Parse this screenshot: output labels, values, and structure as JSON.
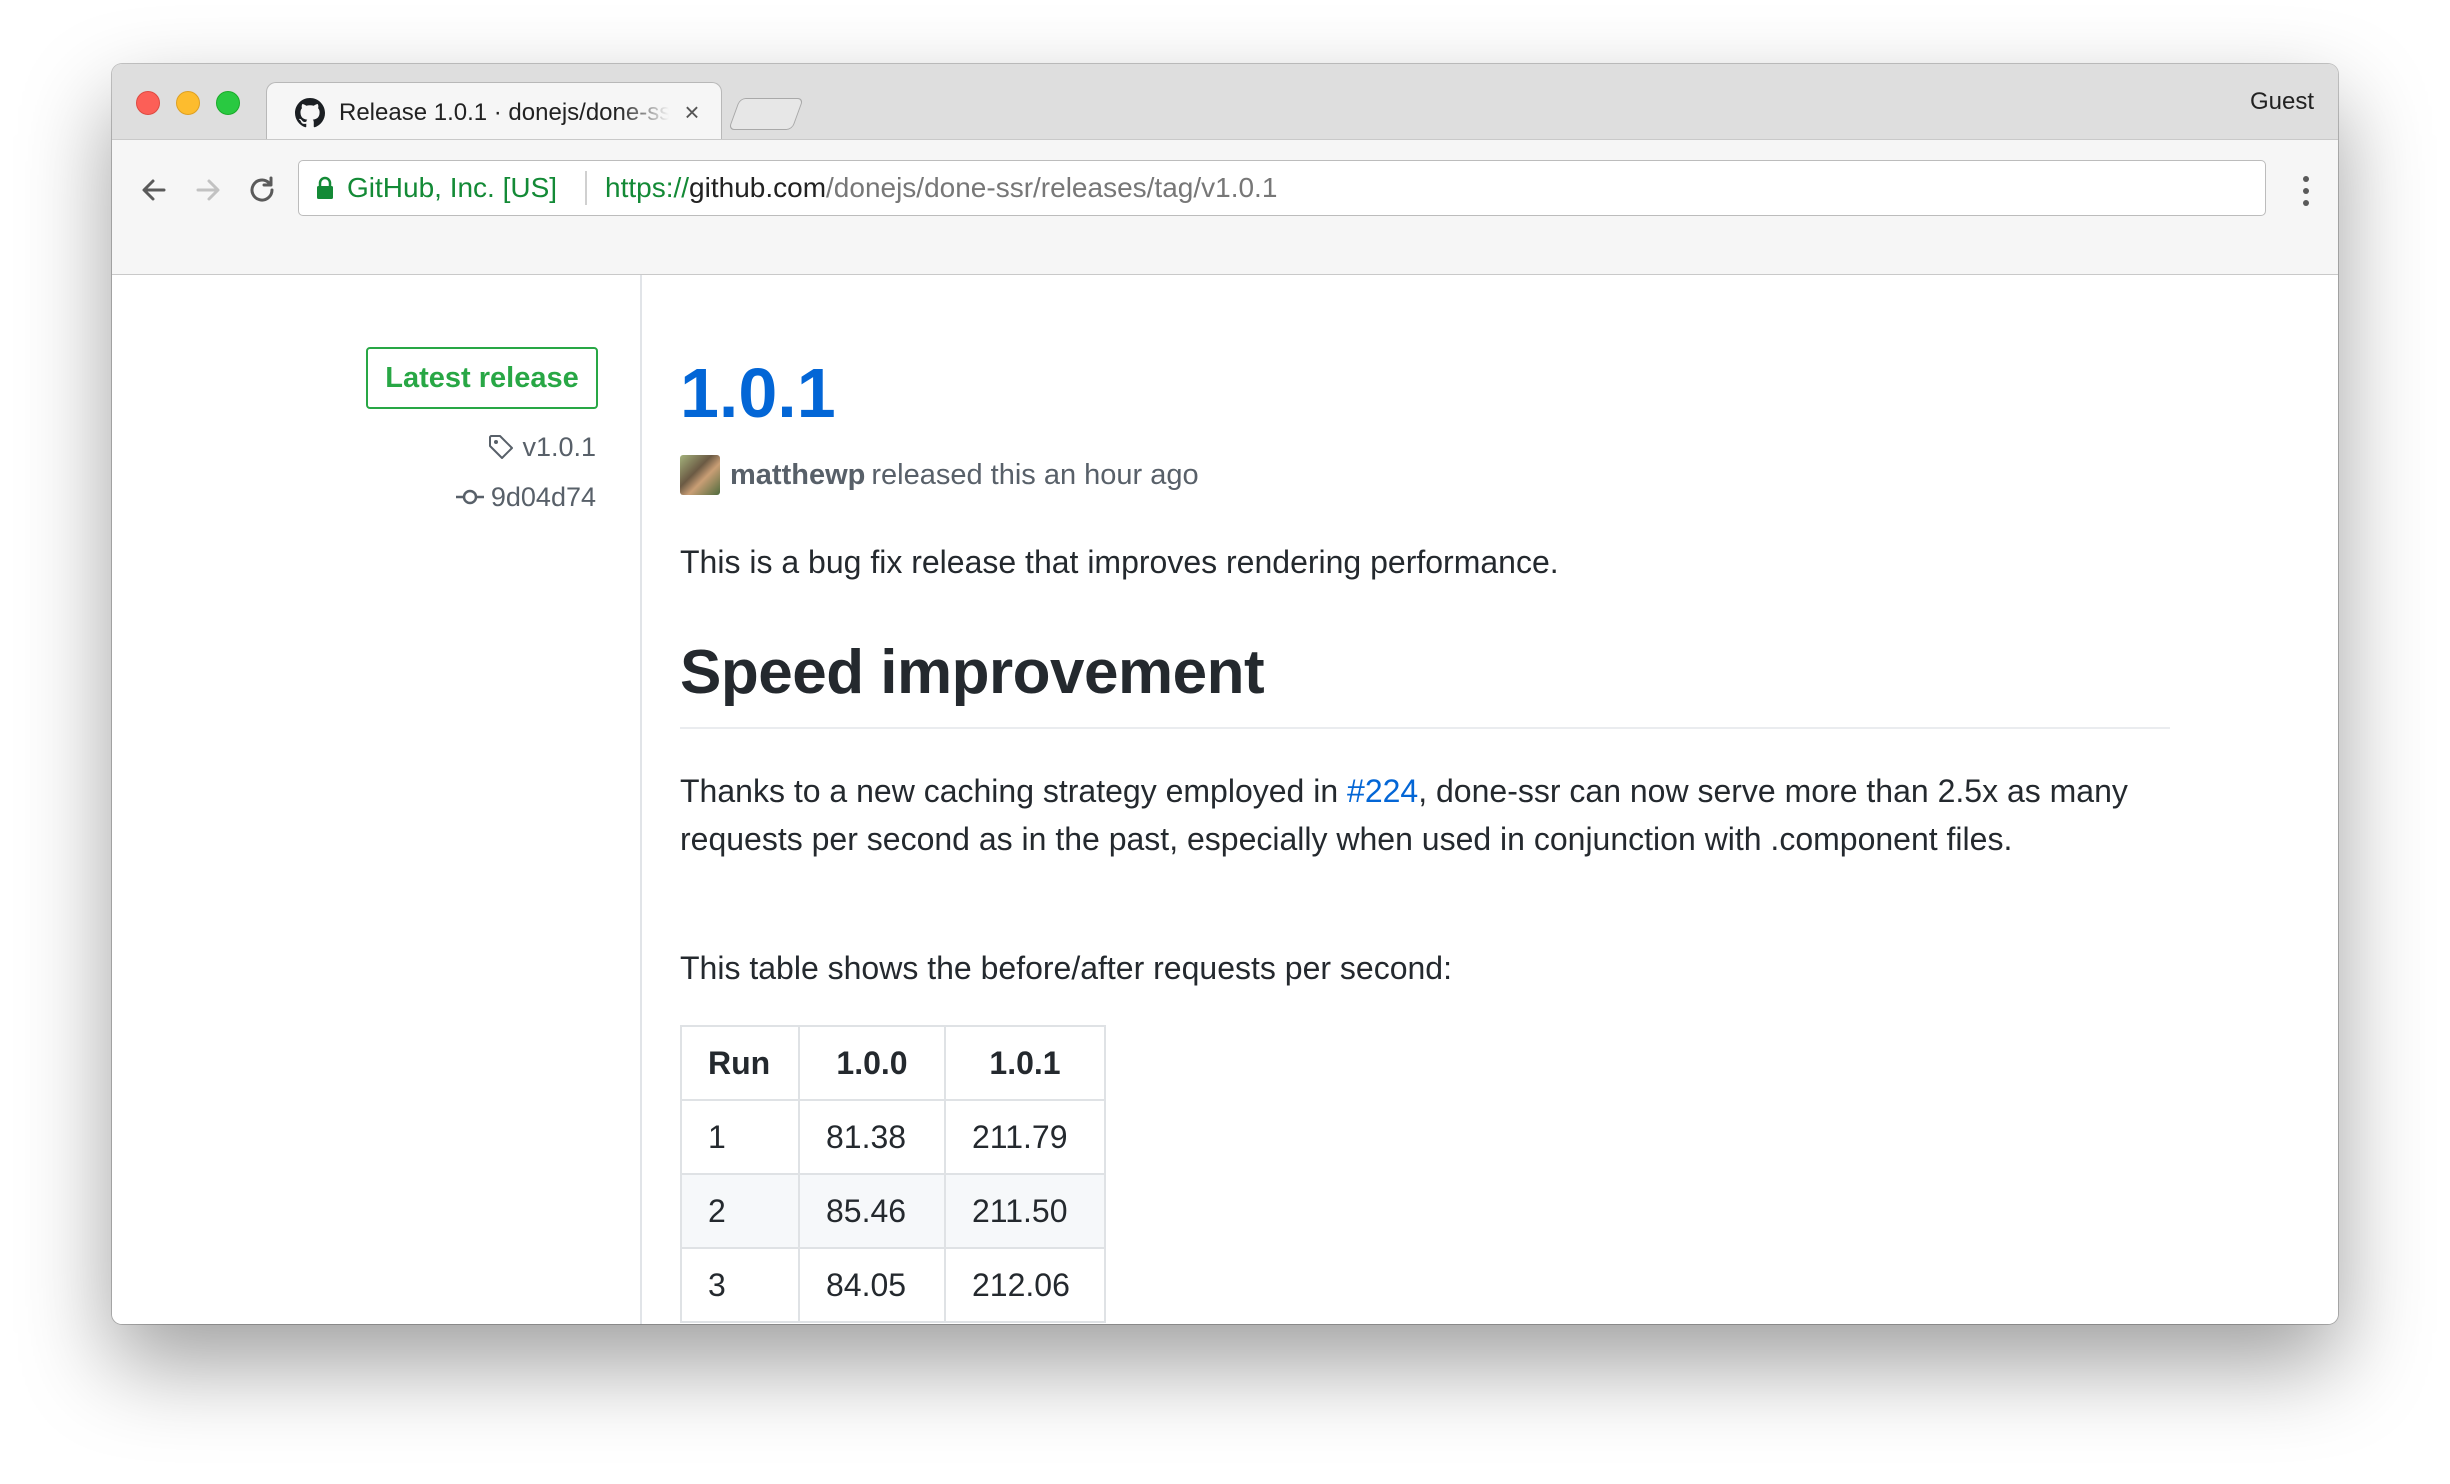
{
  "browser": {
    "tab_title": "Release 1.0.1 · donejs/done-ssr",
    "tab_close": "×",
    "profile": "Guest",
    "security_label": "GitHub, Inc. [US]",
    "url_scheme": "https://",
    "url_host": "github.com",
    "url_path": "/donejs/done-ssr/releases/tag/v1.0.1",
    "icons": {
      "back": "back-arrow-icon",
      "forward": "forward-arrow-icon",
      "reload": "reload-icon",
      "lock": "lock-icon",
      "menu": "kebab-menu-icon",
      "favicon": "github-octocat-icon"
    }
  },
  "sidebar": {
    "badge": "Latest release",
    "tag": "v1.0.1",
    "commit": "9d04d74",
    "accent": "#28a745"
  },
  "release": {
    "title": "1.0.1",
    "author": "matthewp",
    "released_text": "released this an hour ago",
    "intro": "This is a bug fix release that improves rendering performance.",
    "heading": "Speed improvement",
    "para_before_link": "Thanks to a new caching strategy employed in ",
    "issue_link": "#224",
    "para_after_link": ", done-ssr can now serve more than 2.5x as many requests per second as in the past, especially when used in conjunction with .component files.",
    "table_intro": "This table shows the before/after requests per second:",
    "link_color": "#0366d6"
  },
  "table": {
    "headers": [
      "Run",
      "1.0.0",
      "1.0.1"
    ],
    "rows": [
      [
        "1",
        "81.38",
        "211.79"
      ],
      [
        "2",
        "85.46",
        "211.50"
      ],
      [
        "3",
        "84.05",
        "212.06"
      ]
    ]
  }
}
